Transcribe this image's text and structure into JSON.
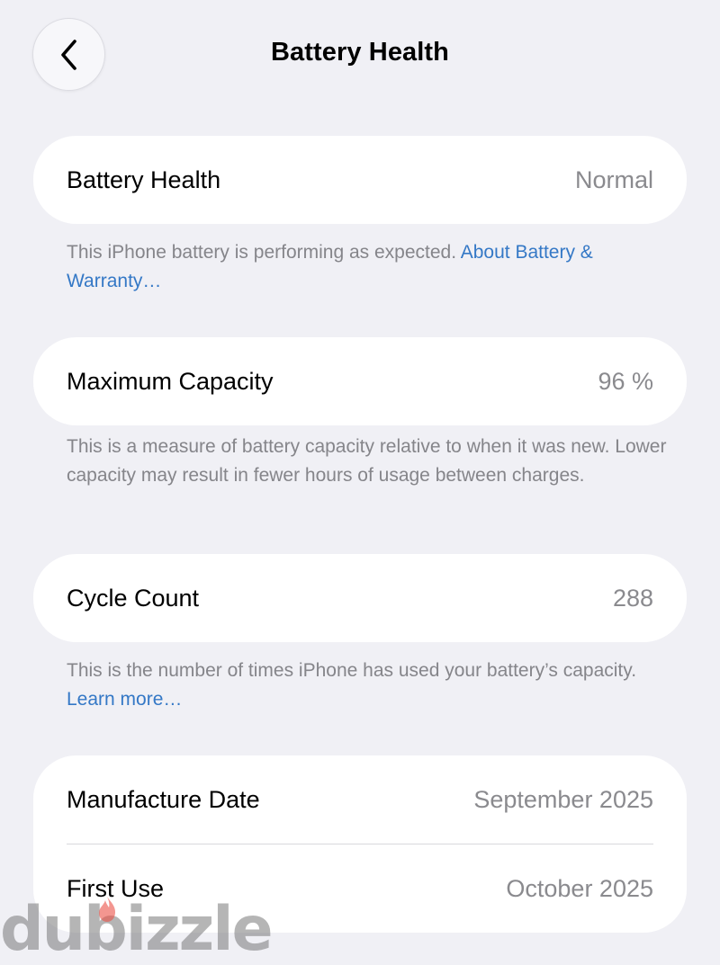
{
  "nav": {
    "title": "Battery Health"
  },
  "battery_health": {
    "label": "Battery Health",
    "value": "Normal",
    "footnote": "This iPhone battery is performing as expected. ",
    "footnote_link": "About Battery & Warranty…"
  },
  "max_capacity": {
    "label": "Maximum Capacity",
    "value": "96 %",
    "footnote": "This is a measure of battery capacity relative to when it was new. Lower capacity may result in fewer hours of usage between charges."
  },
  "cycle_count": {
    "label": "Cycle Count",
    "value": "288",
    "footnote": "This is the number of times iPhone has used your battery’s capacity. ",
    "footnote_link": "Learn more…"
  },
  "dates": {
    "manufacture_label": "Manufacture Date",
    "manufacture_value": "September 2025",
    "first_use_label": "First Use",
    "first_use_value": "October 2025"
  },
  "watermark": {
    "text": "dubizzle"
  },
  "colors": {
    "background": "#f0f0f5",
    "card": "#ffffff",
    "secondary_text": "#8a8a8e",
    "link": "#3478c6"
  }
}
